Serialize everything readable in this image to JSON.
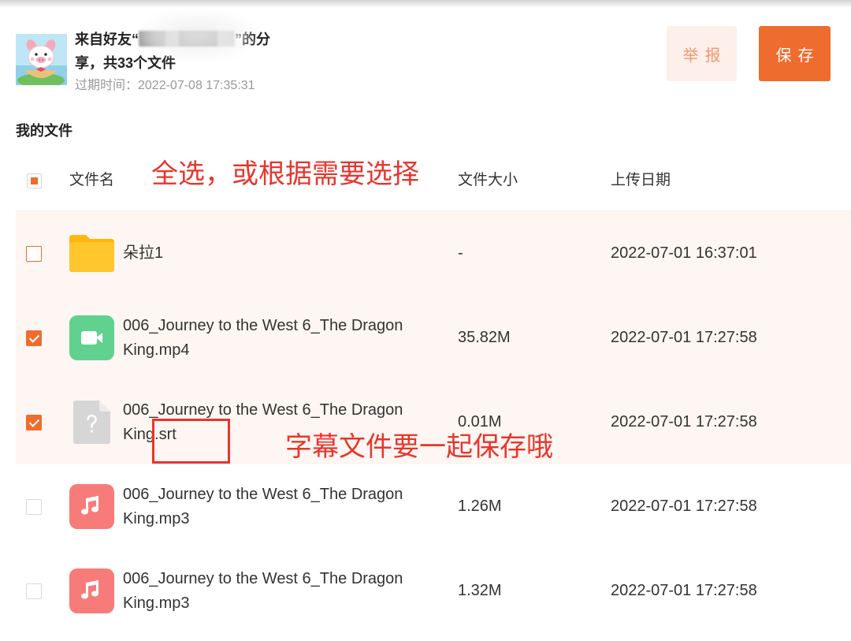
{
  "share": {
    "line1_prefix": "来自好友“",
    "line1_suffix": "”的分",
    "line2": "享，共33个文件",
    "expire": "过期时间：2022-07-08 17:35:31"
  },
  "actions": {
    "report_label": "举报",
    "save_label": "保存"
  },
  "section_title": "我的文件",
  "table": {
    "headers": {
      "name": "文件名",
      "size": "文件大小",
      "date": "上传日期"
    },
    "select_all_partial": true,
    "rows": [
      {
        "icon": "folder-icon",
        "name": "朵拉1",
        "size": "-",
        "date": "2022-07-01 16:37:01",
        "checked": false,
        "highlighted": true
      },
      {
        "icon": "video-file-icon",
        "name": "006_Journey to the West 6_The Dragon King.mp4",
        "size": "35.82M",
        "date": "2022-07-01 17:27:58",
        "checked": true,
        "highlighted": true
      },
      {
        "icon": "unknown-file-icon",
        "name": "006_Journey to the West 6_The Dragon King.srt",
        "size": "0.01M",
        "date": "2022-07-01 17:27:58",
        "checked": true,
        "highlighted": true
      },
      {
        "icon": "audio-file-icon",
        "name": "006_Journey to the West 6_The Dragon King.mp3",
        "size": "1.26M",
        "date": "2022-07-01 17:27:58",
        "checked": false,
        "highlighted": false
      },
      {
        "icon": "audio-file-icon",
        "name": "006_Journey to the West 6_The Dragon King.mp3",
        "size": "1.32M",
        "date": "2022-07-01 17:27:58",
        "checked": false,
        "highlighted": false
      }
    ]
  },
  "annotations": {
    "select_hint": "全选，或根据需要选择",
    "subtitle_hint": "字幕文件要一起保存哦"
  },
  "colors": {
    "accent": "#ee6c2e",
    "report_bg": "#fdf0ea",
    "report_text": "#f4966e",
    "selected_row_bg": "#fef6f2",
    "annotation_red": "#e8352d",
    "video_icon": "#60d18f",
    "audio_icon": "#f77c79",
    "folder_icon": "#ffc62e",
    "unknown_icon": "#d6d6d6"
  }
}
